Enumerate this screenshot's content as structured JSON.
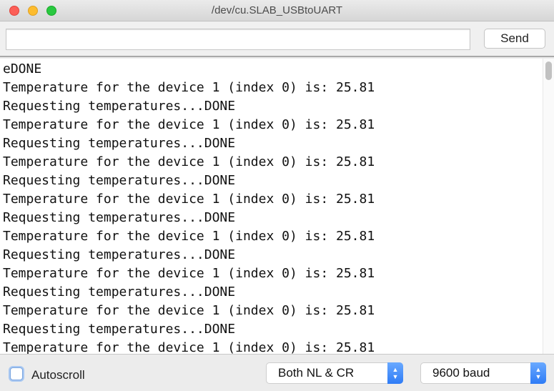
{
  "window": {
    "title": "/dev/cu.SLAB_USBtoUART"
  },
  "toolbar": {
    "input_value": "",
    "send_label": "Send"
  },
  "output": {
    "lines": [
      "eDONE",
      "Temperature for the device 1 (index 0) is: 25.81",
      "Requesting temperatures...DONE",
      "Temperature for the device 1 (index 0) is: 25.81",
      "Requesting temperatures...DONE",
      "Temperature for the device 1 (index 0) is: 25.81",
      "Requesting temperatures...DONE",
      "Temperature for the device 1 (index 0) is: 25.81",
      "Requesting temperatures...DONE",
      "Temperature for the device 1 (index 0) is: 25.81",
      "Requesting temperatures...DONE",
      "Temperature for the device 1 (index 0) is: 25.81",
      "Requesting temperatures...DONE",
      "Temperature for the device 1 (index 0) is: 25.81",
      "Requesting temperatures...DONE",
      "Temperature for the device 1 (index 0) is: 25.81"
    ]
  },
  "footer": {
    "autoscroll_label": "Autoscroll",
    "autoscroll_checked": false,
    "line_ending": "Both NL & CR",
    "baud": "9600 baud"
  }
}
